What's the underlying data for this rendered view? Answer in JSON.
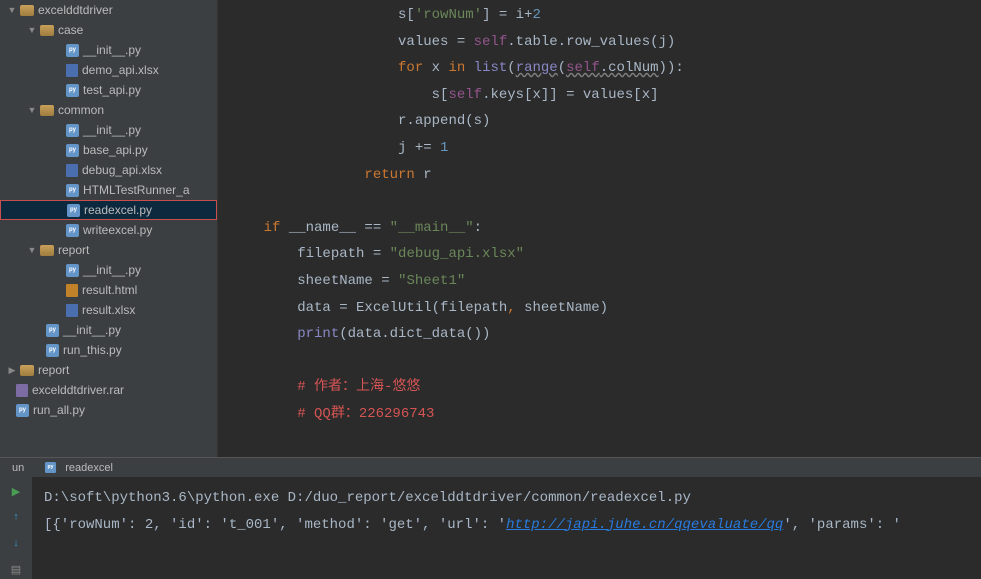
{
  "tree": {
    "root": "excelddtdriver",
    "case": "case",
    "case_init": "__init__.py",
    "case_demo": "demo_api.xlsx",
    "case_test": "test_api.py",
    "common": "common",
    "common_init": "__init__.py",
    "common_base": "base_api.py",
    "common_debug": "debug_api.xlsx",
    "common_htr": "HTMLTestRunner_a",
    "common_read": "readexcel.py",
    "common_write": "writeexcel.py",
    "report": "report",
    "report_init": "__init__.py",
    "report_html": "result.html",
    "report_xlsx": "result.xlsx",
    "root_init": "__init__.py",
    "root_run": "run_this.py",
    "ext_report": "report",
    "ext_rar": "excelddtdriver.rar",
    "ext_runall": "run_all.py"
  },
  "code": {
    "l1_a": "s[",
    "l1_b": "'rowNum'",
    "l1_c": "] = i+",
    "l1_d": "2",
    "l2_a": "values = ",
    "l2_b": "self",
    "l2_c": ".table.row_values(j)",
    "l3_a": "for",
    "l3_b": " x ",
    "l3_c": "in",
    "l3_d": " list",
    "l3_e": "(",
    "l3_f": "range",
    "l3_g": "(",
    "l3_h": "self",
    "l3_i": ".colNum",
    "l3_j": ")):",
    "l4_a": "s[",
    "l4_b": "self",
    "l4_c": ".keys[x]] = values[x]",
    "l5_a": "r.append(s)",
    "l6_a": "j += ",
    "l6_b": "1",
    "l7_a": "return",
    "l7_b": " r",
    "l9_a": "if",
    "l9_b": " __name__ == ",
    "l9_c": "\"__main__\"",
    "l9_d": ":",
    "l10_a": "filepath = ",
    "l10_b": "\"debug_api.xlsx\"",
    "l11_a": "sheetName = ",
    "l11_b": "\"Sheet1\"",
    "l12_a": "data = ExcelUtil(filepath",
    "l12_b": ",",
    "l12_c": " sheetName)",
    "l13_a": "print",
    "l13_b": "(data.dict_data())",
    "l15_a": "# 作者：上海-悠悠",
    "l16_a": "# QQ群：226296743"
  },
  "tabs": {
    "left": "un",
    "right": "readexcel"
  },
  "console": {
    "line1": "D:\\soft\\python3.6\\python.exe D:/duo_report/excelddtdriver/common/readexcel.py",
    "line2_a": "[{'rowNum': 2, 'id': 't_001', 'method': 'get', 'url': '",
    "line2_link": "http://japi.juhe.cn/qqevaluate/qq",
    "line2_b": "', 'params': '"
  }
}
